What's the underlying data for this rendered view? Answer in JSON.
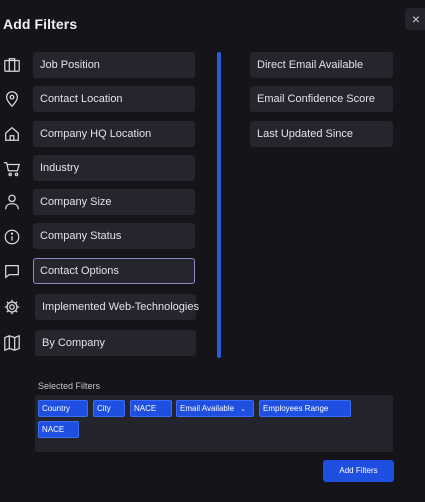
{
  "modal": {
    "title": "Add Filters",
    "close_label": "×"
  },
  "filters_left": [
    {
      "label": "Job Position",
      "icon": "briefcase-icon"
    },
    {
      "label": "Contact Location",
      "icon": "location-pin-icon"
    },
    {
      "label": "Company HQ Location",
      "icon": "home-icon"
    },
    {
      "label": "Industry",
      "icon": "cart-icon"
    },
    {
      "label": "Company Size",
      "icon": "user-icon"
    },
    {
      "label": "Company Status",
      "icon": "info-icon"
    },
    {
      "label": "Contact Options",
      "icon": "chat-icon"
    },
    {
      "label": "Implemented Web-Technologies",
      "icon": "gear-icon"
    },
    {
      "label": "By Company",
      "icon": "map-icon"
    }
  ],
  "filters_right": [
    {
      "label": "Direct Email Available"
    },
    {
      "label": "Email Confidence Score"
    },
    {
      "label": "Last Updated Since"
    }
  ],
  "selected": {
    "label": "Selected Filters",
    "chips": [
      "Country",
      "City",
      "NACE",
      "Email Available",
      "Employees Range",
      "NACE"
    ]
  },
  "actions": {
    "add_filters_label": "Add Filters"
  },
  "colors": {
    "accent": "#1f4fe0",
    "background": "#141419",
    "button": "#25252e"
  }
}
